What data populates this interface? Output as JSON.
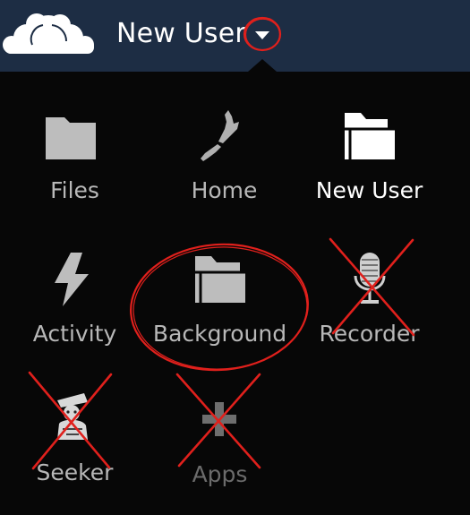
{
  "header": {
    "logo_icon": "owncloud-logo-icon",
    "user_name": "New User",
    "caret_icon": "caret-down-icon",
    "background_color": "#1d2d44"
  },
  "menu": {
    "apps": [
      {
        "label": "Files",
        "icon": "folder-icon"
      },
      {
        "label": "Home",
        "icon": "new-zealand-map-icon"
      },
      {
        "label": "New User",
        "icon": "folder-icon",
        "active": true
      },
      {
        "label": "Activity",
        "icon": "lightning-icon"
      },
      {
        "label": "Background",
        "icon": "folder-icon"
      },
      {
        "label": "Recorder",
        "icon": "microphone-icon"
      },
      {
        "label": "Seeker",
        "icon": "seeker-icon"
      },
      {
        "label": "Apps",
        "icon": "plus-icon"
      }
    ]
  },
  "annotations": {
    "color": "#e0201c",
    "circled": [
      "caret-down-icon",
      "Background"
    ],
    "crossed_out": [
      "Recorder",
      "Seeker",
      "Apps"
    ]
  }
}
